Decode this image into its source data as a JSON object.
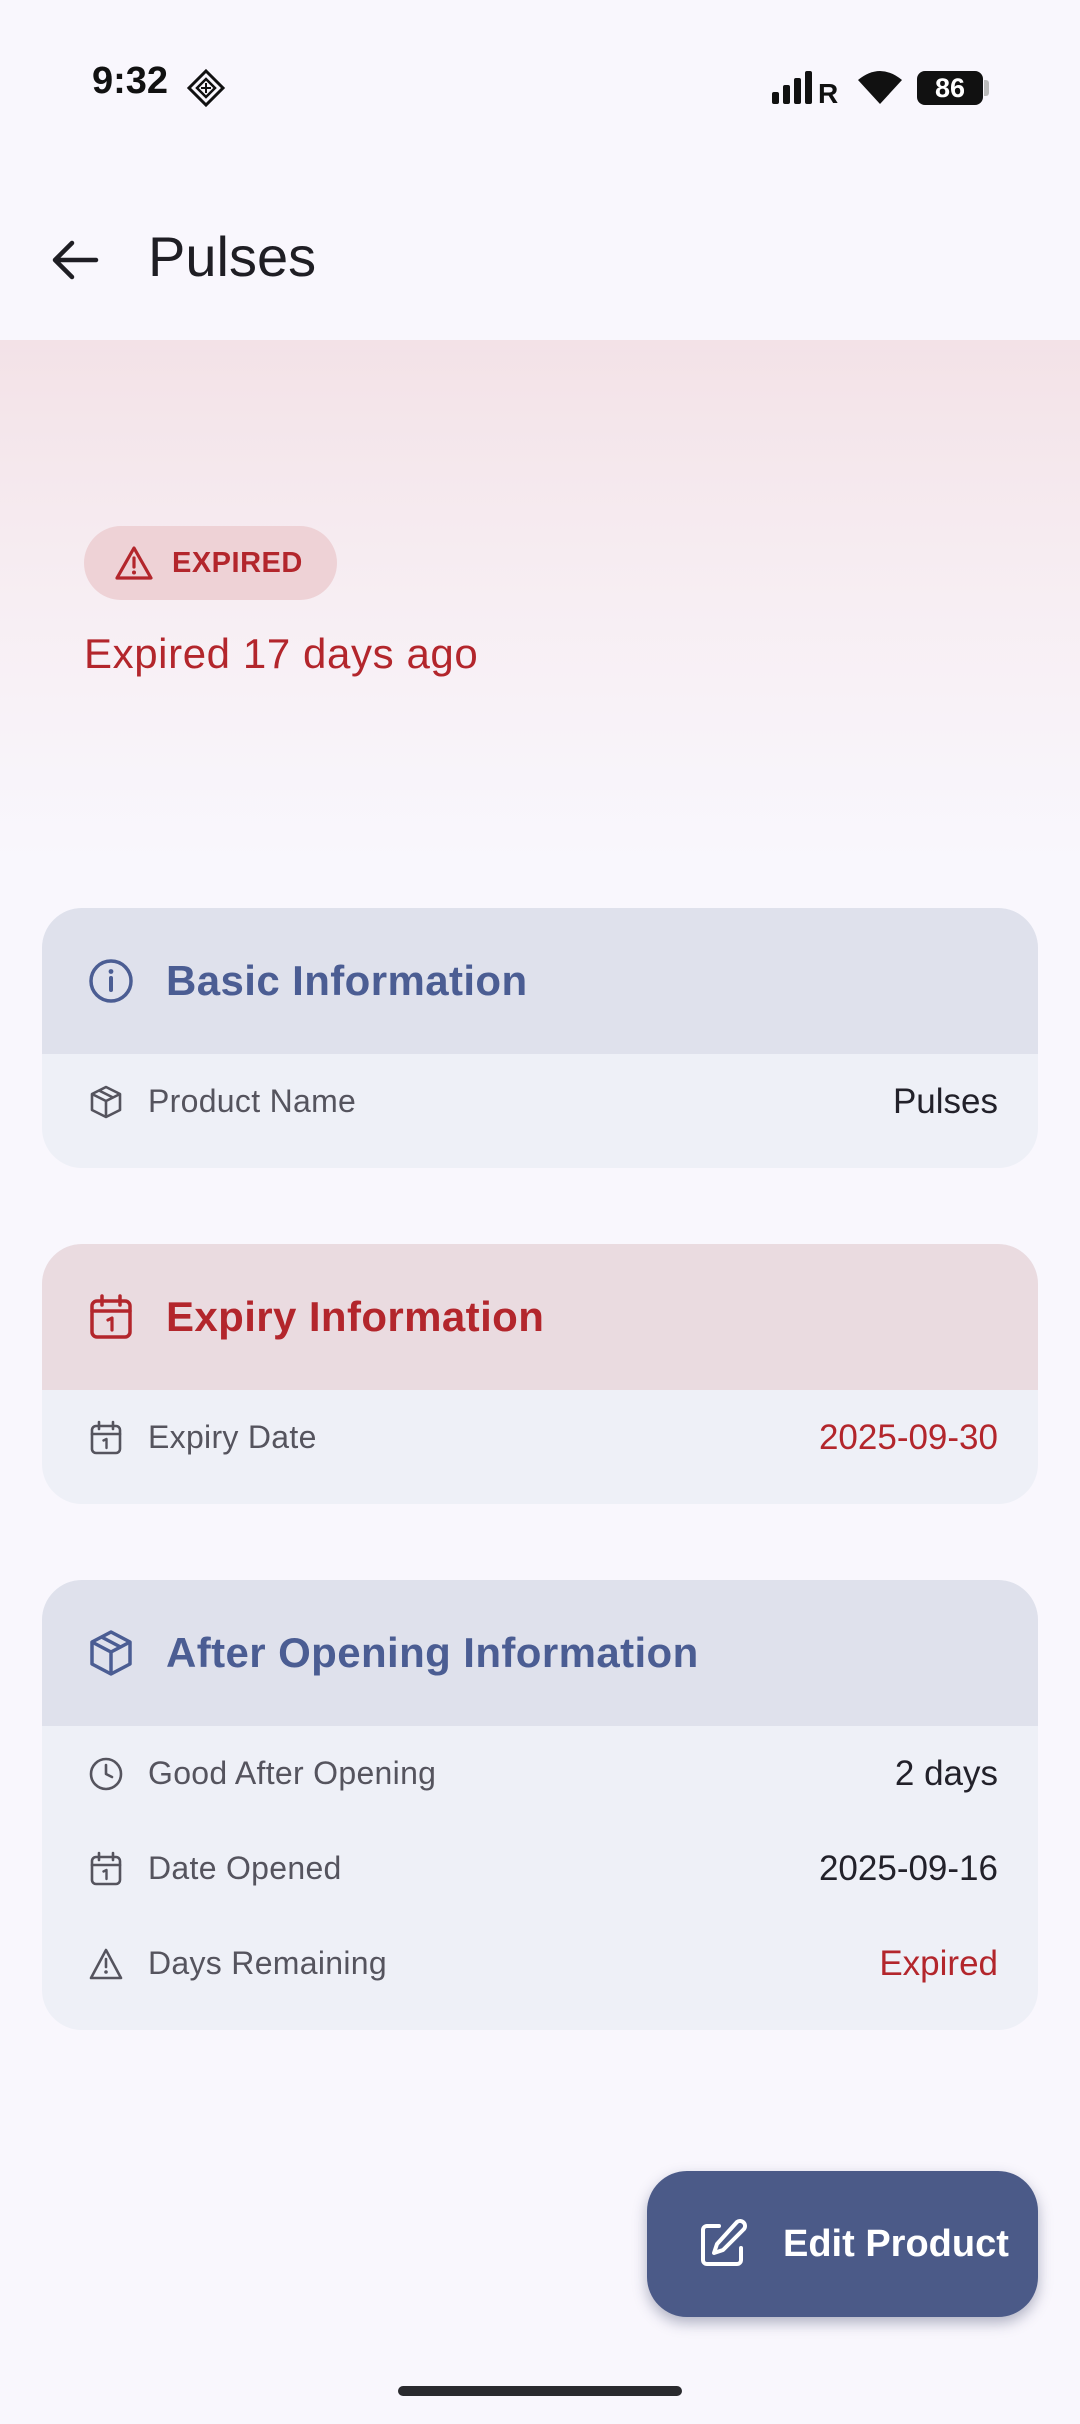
{
  "status_bar": {
    "time": "9:32",
    "battery": "86"
  },
  "app_bar": {
    "title": "Pulses"
  },
  "hero": {
    "badge": "EXPIRED",
    "status_text": "Expired 17 days ago"
  },
  "basic_info": {
    "title": "Basic Information",
    "rows": [
      {
        "label": "Product Name",
        "value": "Pulses"
      }
    ]
  },
  "expiry_info": {
    "title": "Expiry Information",
    "rows": [
      {
        "label": "Expiry Date",
        "value": "2025-09-30"
      }
    ]
  },
  "after_opening": {
    "title": "After Opening Information",
    "rows": [
      {
        "label": "Good After Opening",
        "value": "2 days"
      },
      {
        "label": "Date Opened",
        "value": "2025-09-16"
      },
      {
        "label": "Days Remaining",
        "value": "Expired"
      }
    ]
  },
  "fab": {
    "label": "Edit Product"
  },
  "colors": {
    "error": "#b3262c",
    "primary": "#4b5d93",
    "fab": "#4b5a88"
  }
}
